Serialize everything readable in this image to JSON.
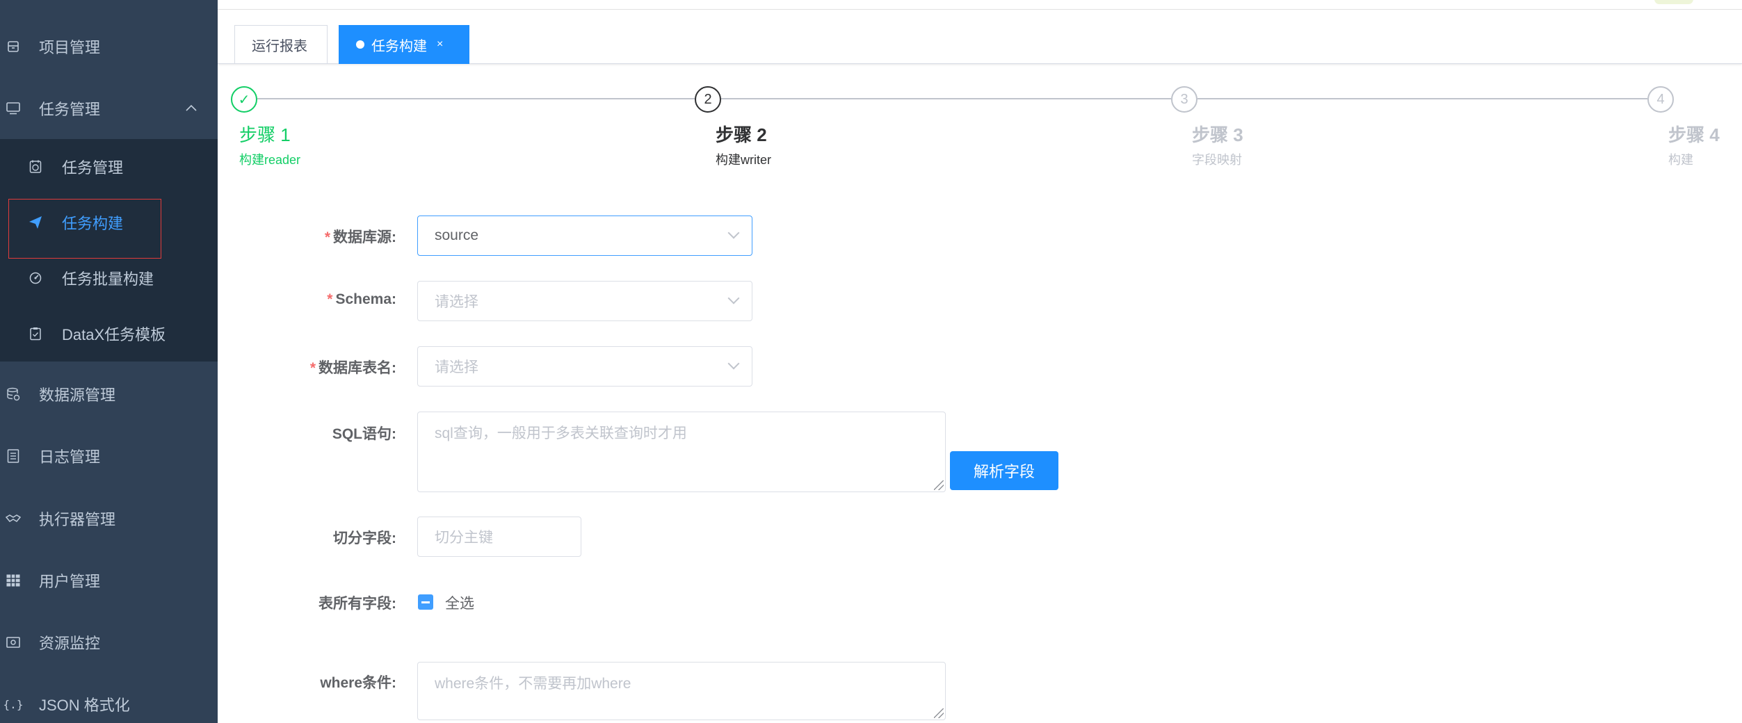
{
  "sidebar": {
    "items": [
      {
        "label": "项目管理",
        "icon": "project-icon"
      },
      {
        "label": "任务管理",
        "icon": "monitor-icon"
      },
      {
        "label": "数据源管理",
        "icon": "database-icon"
      },
      {
        "label": "日志管理",
        "icon": "document-icon"
      },
      {
        "label": "执行器管理",
        "icon": "handshake-icon"
      },
      {
        "label": "用户管理",
        "icon": "grid-icon"
      },
      {
        "label": "资源监控",
        "icon": "money-icon"
      },
      {
        "label": "JSON 格式化",
        "icon": "braces-icon"
      }
    ],
    "submenu": [
      {
        "label": "任务管理",
        "icon": "clock-icon"
      },
      {
        "label": "任务构建",
        "icon": "send-icon"
      },
      {
        "label": "任务批量构建",
        "icon": "dashboard-icon"
      },
      {
        "label": "DataX任务模板",
        "icon": "clipboard-icon"
      }
    ]
  },
  "tabs": [
    {
      "label": "运行报表"
    },
    {
      "label": "任务构建",
      "close": "×"
    }
  ],
  "steps": [
    {
      "number": "✓",
      "title": "步骤 1",
      "desc": "构建reader",
      "status": "done"
    },
    {
      "number": "2",
      "title": "步骤 2",
      "desc": "构建writer",
      "status": "active"
    },
    {
      "number": "3",
      "title": "步骤 3",
      "desc": "字段映射",
      "status": "wait"
    },
    {
      "number": "4",
      "title": "步骤 4",
      "desc": "构建",
      "status": "wait"
    }
  ],
  "form": {
    "datasource": {
      "label": "数据库源:",
      "required": "*",
      "value": "source"
    },
    "schema": {
      "label": "Schema:",
      "required": "*",
      "placeholder": "请选择"
    },
    "table": {
      "label": "数据库表名:",
      "required": "*",
      "placeholder": "请选择"
    },
    "sql": {
      "label": "SQL语句:",
      "placeholder": "sql查询，一般用于多表关联查询时才用"
    },
    "parse_button": "解析字段",
    "split": {
      "label": "切分字段:",
      "placeholder": "切分主键"
    },
    "all_fields": {
      "label": "表所有字段:",
      "checkbox_label": "全选"
    },
    "where": {
      "label": "where条件:",
      "placeholder": "where条件，不需要再加where"
    }
  },
  "colors": {
    "sidebar_bg": "#304156",
    "submenu_bg": "#1f2d3d",
    "primary": "#1e8fff",
    "success": "#13ce66",
    "required": "#f56c6c"
  }
}
